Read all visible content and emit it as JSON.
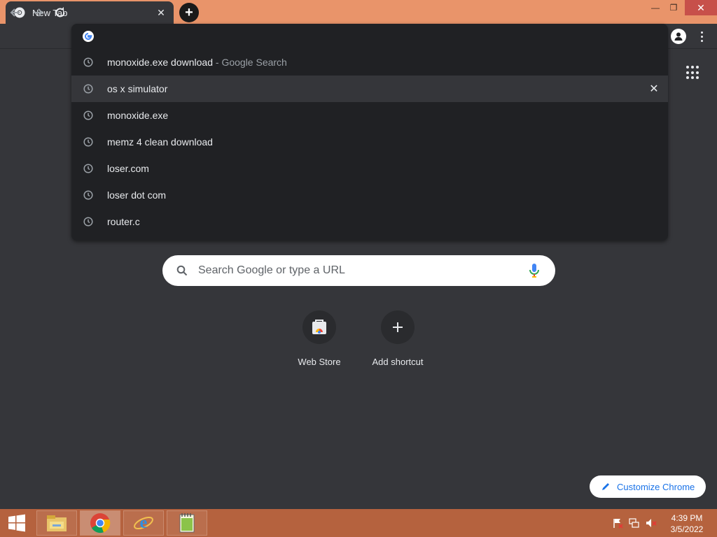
{
  "tab": {
    "title": "New Tab",
    "close_glyph": "✕"
  },
  "new_tab_glyph": "+",
  "window_controls": {
    "minimize": "—",
    "maximize": "❐",
    "close": "✕"
  },
  "omnibox": {
    "value": "",
    "suggestions": [
      {
        "text": "monoxide.exe download",
        "sub": " - Google Search",
        "selected": false
      },
      {
        "text": "os x simulator",
        "sub": "",
        "selected": true
      },
      {
        "text": "monoxide.exe",
        "sub": "",
        "selected": false
      },
      {
        "text": "memz 4 clean download",
        "sub": "",
        "selected": false
      },
      {
        "text": "loser.com",
        "sub": "",
        "selected": false
      },
      {
        "text": "loser dot com",
        "sub": "",
        "selected": false
      },
      {
        "text": "router.c",
        "sub": "",
        "selected": false
      }
    ],
    "remove_glyph": "✕"
  },
  "search": {
    "placeholder": "Search Google or type a URL"
  },
  "shortcuts": [
    {
      "label": "Web Store",
      "icon": "web-store-icon"
    },
    {
      "label": "Add shortcut",
      "icon": "plus-icon"
    }
  ],
  "customize": {
    "label": "Customize Chrome"
  },
  "taskbar": {
    "apps": [
      "file-explorer-icon",
      "chrome-icon",
      "internet-explorer-icon",
      "notepad-plus-plus-icon"
    ],
    "clock": {
      "time": "4:39 PM",
      "date": "3/5/2022"
    }
  },
  "colors": {
    "titlebar": "#e9946a",
    "background": "#35363a",
    "omnibox": "#202124",
    "accent": "#1a73e8",
    "taskbar": "#b5623e"
  }
}
